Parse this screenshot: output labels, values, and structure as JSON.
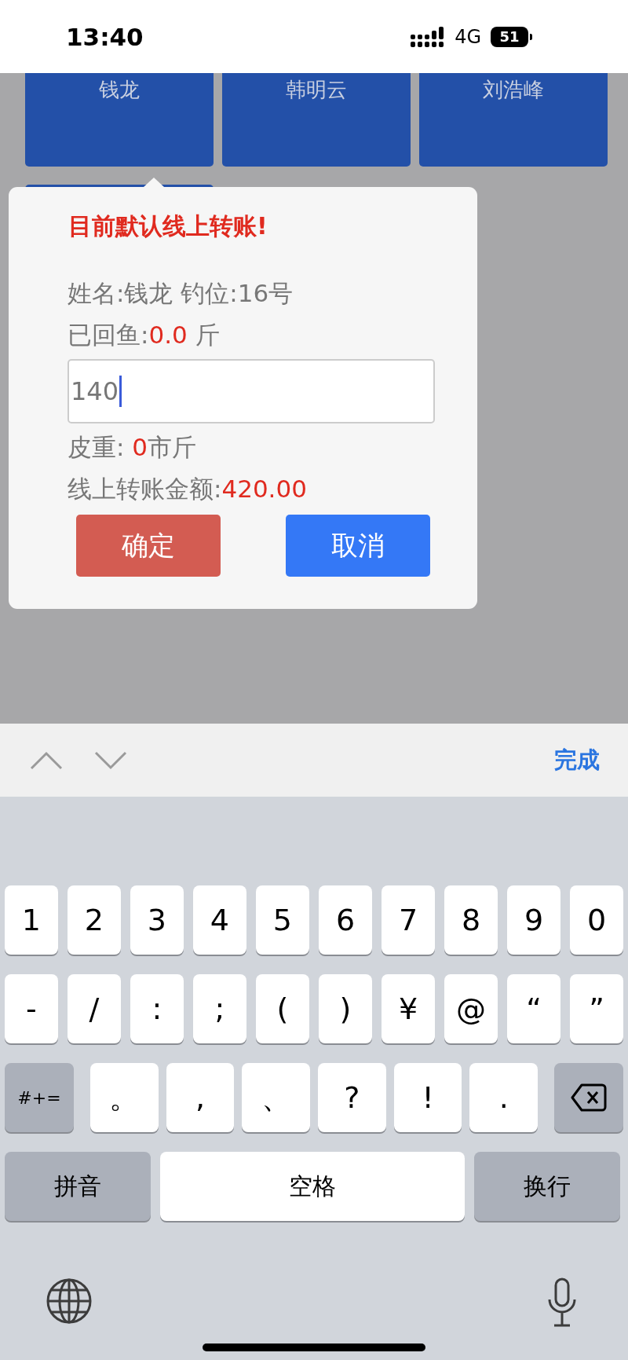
{
  "status_bar": {
    "time": "13:40",
    "network": "4G",
    "battery": "51"
  },
  "tiles": [
    {
      "name": "钱龙"
    },
    {
      "name": "韩明云"
    },
    {
      "name": "刘浩峰"
    }
  ],
  "dialog": {
    "title": "目前默认线上转账!",
    "lines": [
      {
        "label": "姓名:钱龙 钓位:16号"
      },
      {
        "label": "已回鱼:",
        "value": "0.0",
        "unit": " 斤"
      }
    ],
    "input": {
      "value": "140",
      "focused": true
    },
    "lines_after": [
      {
        "label": "皮重: ",
        "value": "0",
        "unit": "市斤"
      },
      {
        "label": "线上转账金额:",
        "value": "420.00"
      }
    ],
    "buttons": [
      {
        "label": "确定",
        "kind": "confirm"
      },
      {
        "label": "取消",
        "kind": "cancel"
      }
    ]
  },
  "keyboard_toolbar": {
    "done": "完成"
  },
  "keyboard": {
    "rows": [
      {
        "keys": [
          {
            "kind": "char",
            "label": "1"
          },
          {
            "kind": "char",
            "label": "2"
          },
          {
            "kind": "char",
            "label": "3"
          },
          {
            "kind": "char",
            "label": "4"
          },
          {
            "kind": "char",
            "label": "5"
          },
          {
            "kind": "char",
            "label": "6"
          },
          {
            "kind": "char",
            "label": "7"
          },
          {
            "kind": "char",
            "label": "8"
          },
          {
            "kind": "char",
            "label": "9"
          },
          {
            "kind": "char",
            "label": "0"
          }
        ]
      },
      {
        "keys": [
          {
            "kind": "char",
            "label": "-"
          },
          {
            "kind": "char",
            "label": "/"
          },
          {
            "kind": "char",
            "label": ":"
          },
          {
            "kind": "char",
            "label": ";"
          },
          {
            "kind": "char",
            "label": "("
          },
          {
            "kind": "char",
            "label": ")"
          },
          {
            "kind": "char",
            "label": "¥"
          },
          {
            "kind": "char",
            "label": "@"
          },
          {
            "kind": "char",
            "label": "“"
          },
          {
            "kind": "char",
            "label": "”"
          }
        ]
      },
      {
        "keys": [
          {
            "kind": "function",
            "label": "#+="
          },
          {
            "kind": "char",
            "label": "。"
          },
          {
            "kind": "char",
            "label": ","
          },
          {
            "kind": "char",
            "label": "、"
          },
          {
            "kind": "char",
            "label": "?"
          },
          {
            "kind": "char",
            "label": "!"
          },
          {
            "kind": "char",
            "label": "."
          },
          {
            "kind": "delete"
          }
        ]
      },
      {
        "keys": [
          {
            "kind": "function",
            "label": "拼音"
          },
          {
            "kind": "space",
            "label": "空格"
          },
          {
            "kind": "function",
            "label": "换行"
          }
        ]
      }
    ]
  }
}
